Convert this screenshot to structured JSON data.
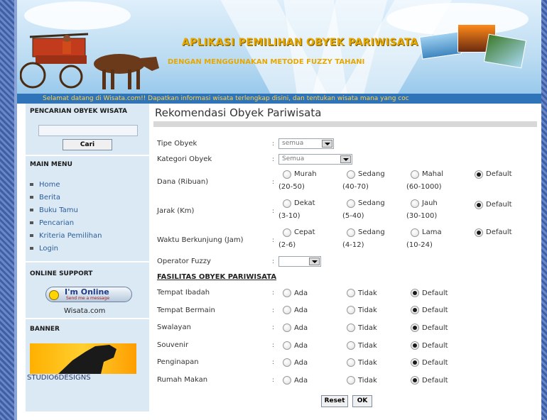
{
  "header": {
    "title_line1": "APLIKASI PEMILIHAN OBYEK PARIWISATA",
    "title_line2": "DENGAN MENGGUNAKAN METODE FUZZY TAHANI",
    "marquee": "Selamat datang di Wisata.com!! Dapatkan informasi wisata terlengkap disini, dan tentukan wisata mana yang coc"
  },
  "sidebar": {
    "search_heading": "PENCARIAN OBYEK WISATA",
    "search_button": "Cari",
    "menu_heading": "MAIN MENU",
    "menu": [
      "Home",
      "Berita",
      "Buku Tamu",
      "Pencarian",
      "Kriteria Pemilihan",
      "Login"
    ],
    "support_heading": "ONLINE SUPPORT",
    "ym_main": "I'm Online",
    "ym_sub": "Send me a message",
    "support_site": "Wisata.com",
    "banner_heading": "BANNER",
    "banner_label": "STUDIO6DESIGNS"
  },
  "main": {
    "title": "Rekomendasi Obyek Pariwisata",
    "tipe": {
      "label": "Tipe Obyek",
      "value": "semua"
    },
    "kategori": {
      "label": "Kategori Obyek",
      "value": "Semua"
    },
    "dana": {
      "label": "Dana (Ribuan)",
      "options": [
        {
          "l1": "Murah",
          "l2": "(20-50)"
        },
        {
          "l1": "Sedang",
          "l2": "(40-70)"
        },
        {
          "l1": "Mahal",
          "l2": "(60-1000)"
        },
        {
          "l1": "Default",
          "l2": ""
        }
      ]
    },
    "jarak": {
      "label": "Jarak (Km)",
      "options": [
        {
          "l1": "Dekat",
          "l2": "(3-10)"
        },
        {
          "l1": "Sedang",
          "l2": "(5-40)"
        },
        {
          "l1": "Jauh",
          "l2": "(30-100)"
        },
        {
          "l1": "Default",
          "l2": ""
        }
      ]
    },
    "waktu": {
      "label": "Waktu Berkunjung (Jam)",
      "options": [
        {
          "l1": "Cepat",
          "l2": "(2-6)"
        },
        {
          "l1": "Sedang",
          "l2": "(4-12)"
        },
        {
          "l1": "Lama",
          "l2": "(10-24)"
        },
        {
          "l1": "Default",
          "l2": ""
        }
      ]
    },
    "operator": {
      "label": "Operator Fuzzy",
      "value": ""
    },
    "fasilitas_heading": "FASILITAS OBYEK PARIWISATA",
    "fasilitas_options": [
      "Ada",
      "Tidak",
      "Default"
    ],
    "fasilitas": [
      "Tempat Ibadah",
      "Tempat Bermain",
      "Swalayan",
      "Souvenir",
      "Penginapan",
      "Rumah Makan"
    ],
    "reset_label": "Reset",
    "ok_label": "OK"
  }
}
